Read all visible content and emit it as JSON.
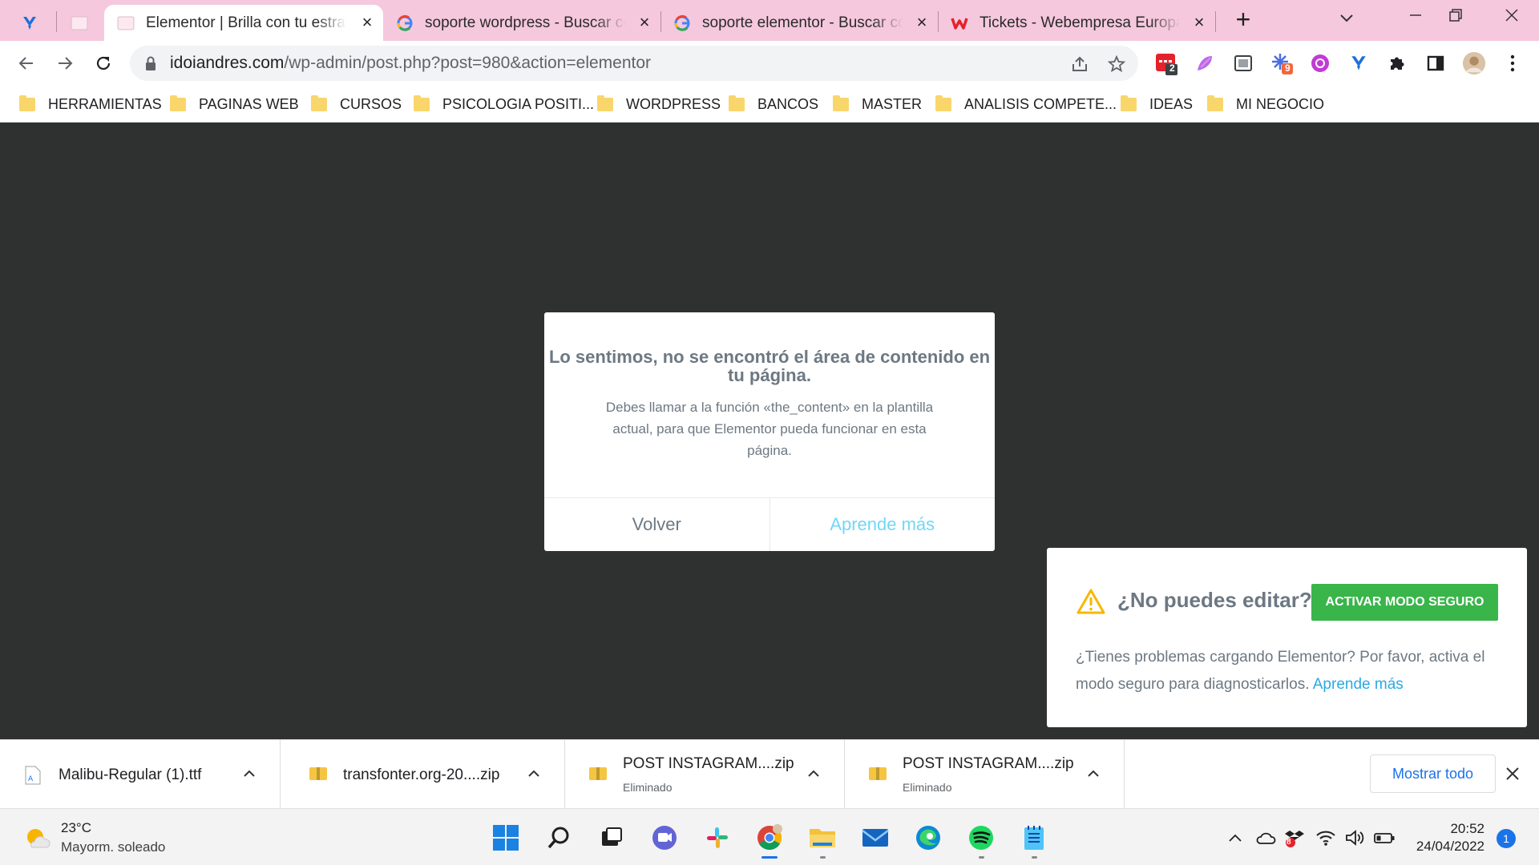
{
  "browser": {
    "tabs": [
      {
        "title": "Elementor | Brilla con tu estrategia",
        "active": true
      },
      {
        "title": "soporte wordpress - Buscar con Google",
        "active": false
      },
      {
        "title": "soporte elementor - Buscar con Google",
        "active": false
      },
      {
        "title": "Tickets - Webempresa Europa S.L.",
        "active": false
      }
    ],
    "address": {
      "domain": "idoiandres.com",
      "path": "/wp-admin/post.php?post=980&action=elementor"
    },
    "extensions": {
      "badge_1": "2",
      "badge_2": "9"
    },
    "bookmarks": [
      "HERRAMIENTAS",
      "PAGINAS WEB",
      "CURSOS",
      "PSICOLOGIA POSITI...",
      "WORDPRESS",
      "BANCOS",
      "MASTER",
      "ANALISIS COMPETE...",
      "IDEAS",
      "MI NEGOCIO"
    ]
  },
  "dialog": {
    "title": "Lo sentimos, no se encontró el área de contenido en tu página.",
    "message": "Debes llamar a la función «the_content» en la plantilla actual, para que Elementor pueda funcionar en esta página.",
    "back_label": "Volver",
    "learn_label": "Aprende más"
  },
  "notice": {
    "title": "¿No puedes editar?",
    "button": "ACTIVAR MODO SEGURO",
    "text": "¿Tienes problemas cargando Elementor? Por favor, activa el modo seguro para diagnosticarlos.",
    "link": "Aprende más"
  },
  "downloads": {
    "items": [
      {
        "name": "Malibu-Regular (1).ttf",
        "status": ""
      },
      {
        "name": "transfonter.org-20....zip",
        "status": ""
      },
      {
        "name": "POST INSTAGRAM....zip",
        "status": "Eliminado"
      },
      {
        "name": "POST INSTAGRAM....zip",
        "status": "Eliminado"
      }
    ],
    "show_all": "Mostrar todo"
  },
  "taskbar": {
    "weather_temp": "23°C",
    "weather_condition": "Mayorm. soleado",
    "time": "20:52",
    "date": "24/04/2022",
    "notifications": "1",
    "tray_badge": "8"
  },
  "colors": {
    "tabstrip": "#f5c8dd",
    "canvas": "#2f3030",
    "elementor_gray": "#6d7882",
    "learn_more": "#71d7f7",
    "safe_mode_green": "#39b54a",
    "link_blue": "#2aa9e0"
  }
}
